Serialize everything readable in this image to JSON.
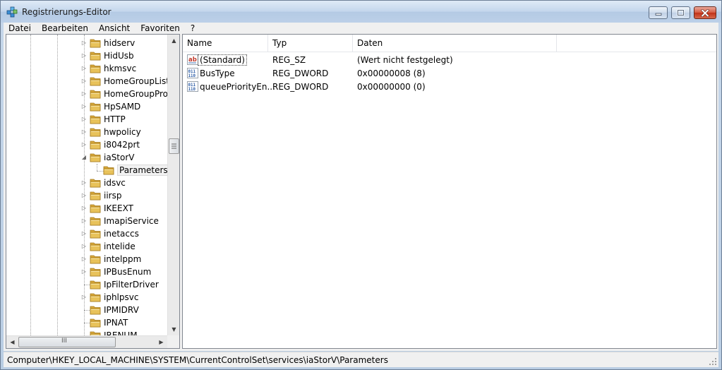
{
  "window": {
    "title": "Registrierungs-Editor"
  },
  "menu": [
    "Datei",
    "Bearbeiten",
    "Ansicht",
    "Favoriten",
    "?"
  ],
  "tree": {
    "items": [
      {
        "label": "hidserv",
        "expandable": true,
        "selected": false
      },
      {
        "label": "HidUsb",
        "expandable": true,
        "selected": false
      },
      {
        "label": "hkmsvc",
        "expandable": true,
        "selected": false
      },
      {
        "label": "HomeGroupListener",
        "expandable": true,
        "selected": false
      },
      {
        "label": "HomeGroupProvider",
        "expandable": true,
        "selected": false
      },
      {
        "label": "HpSAMD",
        "expandable": true,
        "selected": false
      },
      {
        "label": "HTTP",
        "expandable": true,
        "selected": false
      },
      {
        "label": "hwpolicy",
        "expandable": true,
        "selected": false
      },
      {
        "label": "i8042prt",
        "expandable": true,
        "selected": false
      },
      {
        "label": "iaStorV",
        "expandable": true,
        "expanded": true,
        "selected": false
      },
      {
        "label": "Parameters",
        "expandable": false,
        "child": true,
        "selected": true
      },
      {
        "label": "idsvc",
        "expandable": true,
        "selected": false
      },
      {
        "label": "iirsp",
        "expandable": true,
        "selected": false
      },
      {
        "label": "IKEEXT",
        "expandable": true,
        "selected": false
      },
      {
        "label": "ImapiService",
        "expandable": true,
        "selected": false
      },
      {
        "label": "inetaccs",
        "expandable": true,
        "selected": false
      },
      {
        "label": "intelide",
        "expandable": true,
        "selected": false
      },
      {
        "label": "intelppm",
        "expandable": true,
        "selected": false
      },
      {
        "label": "IPBusEnum",
        "expandable": true,
        "selected": false
      },
      {
        "label": "IpFilterDriver",
        "expandable": false,
        "selected": false
      },
      {
        "label": "iphlpsvc",
        "expandable": true,
        "selected": false
      },
      {
        "label": "IPMIDRV",
        "expandable": false,
        "selected": false
      },
      {
        "label": "IPNAT",
        "expandable": false,
        "selected": false
      },
      {
        "label": "IRENUM",
        "expandable": false,
        "selected": false
      }
    ],
    "hscroll_grip": "III"
  },
  "list": {
    "columns": [
      "Name",
      "Typ",
      "Daten"
    ],
    "rows": [
      {
        "icon": "string-value-icon",
        "name": "(Standard)",
        "type": "REG_SZ",
        "data": "(Wert nicht festgelegt)"
      },
      {
        "icon": "binary-value-icon",
        "name": "BusType",
        "type": "REG_DWORD",
        "data": "0x00000008 (8)"
      },
      {
        "icon": "binary-value-icon",
        "name": "queuePriorityEn...",
        "type": "REG_DWORD",
        "data": "0x00000000 (0)"
      }
    ]
  },
  "status": {
    "path": "Computer\\HKEY_LOCAL_MACHINE\\SYSTEM\\CurrentControlSet\\services\\iaStorV\\Parameters"
  },
  "colors": {
    "title_gradient_top": "#dfeaf6",
    "close_button": "#c13218",
    "folder": "#e8c25a",
    "pane_border": "#828790"
  }
}
